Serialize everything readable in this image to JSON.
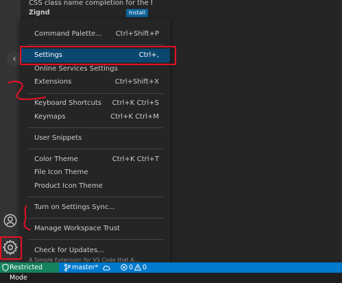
{
  "extension_tooltip": {
    "title": "CSS class name completion for the HT...",
    "author": "Zignd",
    "install_label": "Install"
  },
  "menu": {
    "items": [
      {
        "label": "Command Palette...",
        "shortcut": "Ctrl+Shift+P"
      },
      {
        "label": "Settings",
        "shortcut": "Ctrl+,"
      },
      {
        "label": "Online Services Settings",
        "shortcut": ""
      },
      {
        "label": "Extensions",
        "shortcut": "Ctrl+Shift+X"
      },
      {
        "label": "Keyboard Shortcuts",
        "shortcut": "Ctrl+K Ctrl+S"
      },
      {
        "label": "Keymaps",
        "shortcut": "Ctrl+K Ctrl+M"
      },
      {
        "label": "User Snippets",
        "shortcut": ""
      },
      {
        "label": "Color Theme",
        "shortcut": "Ctrl+K Ctrl+T"
      },
      {
        "label": "File Icon Theme",
        "shortcut": ""
      },
      {
        "label": "Product Icon Theme",
        "shortcut": ""
      },
      {
        "label": "Turn on Settings Sync...",
        "shortcut": ""
      },
      {
        "label": "Manage Workspace Trust",
        "shortcut": ""
      },
      {
        "label": "Check for Updates...",
        "shortcut": ""
      }
    ],
    "selected": "Settings"
  },
  "bottom_description": "A Simple Extension for VS Code that A...",
  "activity_bar": {
    "accounts_icon": "accounts-icon",
    "manage_icon": "gear-icon"
  },
  "status_bar": {
    "restricted_mode": "Restricted Mode",
    "branch": "master*",
    "errors": "0",
    "warnings": "0"
  },
  "colors": {
    "status_bar": "#007acc",
    "restricted_bg": "#16825d",
    "selection": "#094771",
    "annotation": "#e81123"
  }
}
